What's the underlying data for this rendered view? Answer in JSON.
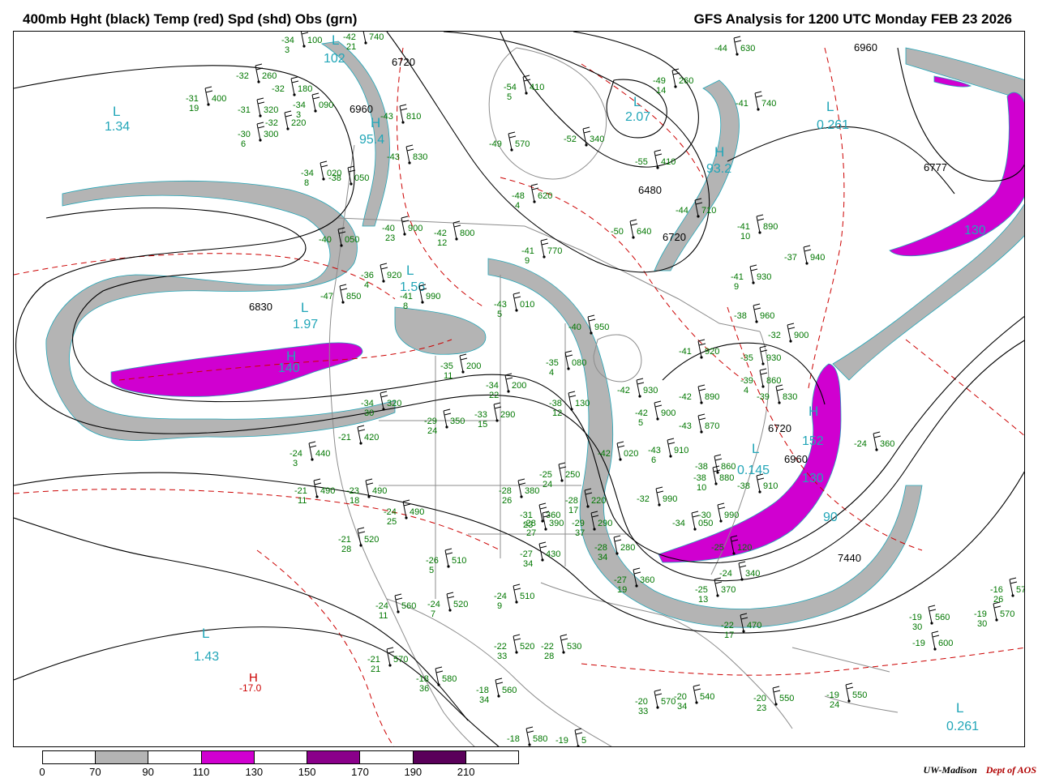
{
  "header": {
    "left_title": "400mb Hght (black) Temp (red) Spd (shd) Obs (grn)",
    "right_title": "GFS Analysis for 1200 UTC Monday  FEB 23 2026"
  },
  "colors": {
    "height_contour": "#000000",
    "temperature_contour": "#cc0000",
    "observation": "#007700",
    "pressure_center": "#22a6b8",
    "political_border": "#888888",
    "speed_70_90": "#b4b4b4",
    "speed_110_130": "#d000d0",
    "speed_150_170": "#8a008a",
    "speed_190_210": "#5a005a"
  },
  "legend": {
    "colors": [
      "#ffffff",
      "#b4b4b4",
      "#ffffff",
      "#d000d0",
      "#ffffff",
      "#8a008a",
      "#ffffff",
      "#5a005a",
      "#ffffff"
    ],
    "labels": [
      "0",
      "70",
      "90",
      "110",
      "130",
      "150",
      "170",
      "190",
      "210"
    ]
  },
  "credit": {
    "org": "UW-Madison",
    "dept": "Dept of AOS"
  },
  "height_labels": [
    "6720",
    "6960",
    "6480",
    "6720",
    "6830",
    "6777",
    "6960",
    "6720",
    "6960",
    "7440"
  ],
  "centers": [
    {
      "letter": "L",
      "value": "1.34"
    },
    {
      "letter": "L",
      "value": "102"
    },
    {
      "letter": "H",
      "value": "95.4"
    },
    {
      "letter": "L",
      "value": "1.56"
    },
    {
      "letter": "L",
      "value": "1.97"
    },
    {
      "letter": "H",
      "value": "140"
    },
    {
      "letter": "L",
      "value": "2.07"
    },
    {
      "letter": "H",
      "value": "93.2"
    },
    {
      "letter": "L",
      "value": "0.261"
    },
    {
      "letter": "L",
      "value": "0.145"
    },
    {
      "letter": "H",
      "value": "152"
    },
    {
      "letter": "L",
      "value": "1.43"
    },
    {
      "letter": "L",
      "value": "0.261"
    }
  ],
  "temp_high": {
    "letter": "H",
    "value": "-17.0"
  },
  "obs": [
    {
      "t": "-34",
      "h": "100",
      "d": "3"
    },
    {
      "t": "-42",
      "h": "740",
      "d": "21"
    },
    {
      "t": "-32",
      "h": "260",
      "d": ""
    },
    {
      "t": "-32",
      "h": "180",
      "d": ""
    },
    {
      "t": "-31",
      "h": "400",
      "d": "19"
    },
    {
      "t": "-34",
      "h": "090",
      "d": "3"
    },
    {
      "t": "-31",
      "h": "320",
      "d": ""
    },
    {
      "t": "-32",
      "h": "220",
      "d": ""
    },
    {
      "t": "-30",
      "h": "300",
      "d": "6"
    },
    {
      "t": "-43",
      "h": "810",
      "d": ""
    },
    {
      "t": "-43",
      "h": "830",
      "d": ""
    },
    {
      "t": "-34",
      "h": "020",
      "d": "8"
    },
    {
      "t": "-38",
      "h": "050",
      "d": ""
    },
    {
      "t": "-40",
      "h": "900",
      "d": "23"
    },
    {
      "t": "-40",
      "h": "050",
      "d": ""
    },
    {
      "t": "-42",
      "h": "800",
      "d": "12"
    },
    {
      "t": "-36",
      "h": "920",
      "d": "4"
    },
    {
      "t": "-41",
      "h": "990",
      "d": "8"
    },
    {
      "t": "-47",
      "h": "850",
      "d": ""
    },
    {
      "t": "-54",
      "h": "410",
      "d": "5"
    },
    {
      "t": "-49",
      "h": "570",
      "d": ""
    },
    {
      "t": "-52",
      "h": "340",
      "d": ""
    },
    {
      "t": "-49",
      "h": "260",
      "d": "14"
    },
    {
      "t": "-55",
      "h": "410",
      "d": ""
    },
    {
      "t": "-48",
      "h": "620",
      "d": "4"
    },
    {
      "t": "-44",
      "h": "630",
      "d": ""
    },
    {
      "t": "-41",
      "h": "740",
      "d": ""
    },
    {
      "t": "-44",
      "h": "710",
      "d": ""
    },
    {
      "t": "-50",
      "h": "640",
      "d": ""
    },
    {
      "t": "-41",
      "h": "770",
      "d": "9"
    },
    {
      "t": "-43",
      "h": "010",
      "d": "5"
    },
    {
      "t": "-40",
      "h": "950",
      "d": ""
    },
    {
      "t": "-41",
      "h": "890",
      "d": "10"
    },
    {
      "t": "-37",
      "h": "940",
      "d": ""
    },
    {
      "t": "-41",
      "h": "930",
      "d": "9"
    },
    {
      "t": "-38",
      "h": "960",
      "d": ""
    },
    {
      "t": "-32",
      "h": "900",
      "d": ""
    },
    {
      "t": "-35",
      "h": "200",
      "d": "11"
    },
    {
      "t": "-34",
      "h": "200",
      "d": "22"
    },
    {
      "t": "-35",
      "h": "080",
      "d": "4"
    },
    {
      "t": "-41",
      "h": "920",
      "d": ""
    },
    {
      "t": "-35",
      "h": "930",
      "d": ""
    },
    {
      "t": "-39",
      "h": "860",
      "d": "4"
    },
    {
      "t": "-39",
      "h": "830",
      "d": ""
    },
    {
      "t": "-42",
      "h": "930",
      "d": ""
    },
    {
      "t": "-42",
      "h": "890",
      "d": ""
    },
    {
      "t": "-38",
      "h": "130",
      "d": "12"
    },
    {
      "t": "-42",
      "h": "900",
      "d": "5"
    },
    {
      "t": "-43",
      "h": "870",
      "d": ""
    },
    {
      "t": "-34",
      "h": "320",
      "d": "30"
    },
    {
      "t": "-29",
      "h": "350",
      "d": "24"
    },
    {
      "t": "-33",
      "h": "290",
      "d": "15"
    },
    {
      "t": "-42",
      "h": "020",
      "d": ""
    },
    {
      "t": "-43",
      "h": "910",
      "d": "6"
    },
    {
      "t": "-38",
      "h": "860",
      "d": ""
    },
    {
      "t": "-38",
      "h": "880",
      "d": "10"
    },
    {
      "t": "-38",
      "h": "910",
      "d": ""
    },
    {
      "t": "-24",
      "h": "360",
      "d": ""
    },
    {
      "t": "-21",
      "h": "420",
      "d": ""
    },
    {
      "t": "-24",
      "h": "440",
      "d": "3"
    },
    {
      "t": "-21",
      "h": "490",
      "d": "11"
    },
    {
      "t": "-23",
      "h": "490",
      "d": "18"
    },
    {
      "t": "-24",
      "h": "490",
      "d": "25"
    },
    {
      "t": "-21",
      "h": "520",
      "d": "28"
    },
    {
      "t": "-25",
      "h": "250",
      "d": "24"
    },
    {
      "t": "-28",
      "h": "380",
      "d": "26"
    },
    {
      "t": "-28",
      "h": "220",
      "d": "17"
    },
    {
      "t": "-31",
      "h": "360",
      "d": "23"
    },
    {
      "t": "-28",
      "h": "390",
      "d": "27"
    },
    {
      "t": "-29",
      "h": "290",
      "d": "37"
    },
    {
      "t": "-32",
      "h": "990",
      "d": ""
    },
    {
      "t": "-34",
      "h": "050",
      "d": ""
    },
    {
      "t": "-30",
      "h": "990",
      "d": ""
    },
    {
      "t": "-26",
      "h": "510",
      "d": "5"
    },
    {
      "t": "-27",
      "h": "430",
      "d": "34"
    },
    {
      "t": "-28",
      "h": "280",
      "d": "34"
    },
    {
      "t": "-27",
      "h": "360",
      "d": "19"
    },
    {
      "t": "-25",
      "h": "120",
      "d": ""
    },
    {
      "t": "-24",
      "h": "340",
      "d": ""
    },
    {
      "t": "-25",
      "h": "370",
      "d": "13"
    },
    {
      "t": "-24",
      "h": "560",
      "d": "11"
    },
    {
      "t": "-24",
      "h": "520",
      "d": "7"
    },
    {
      "t": "-24",
      "h": "510",
      "d": "9"
    },
    {
      "t": "-22",
      "h": "470",
      "d": "17"
    },
    {
      "t": "-22",
      "h": "520",
      "d": "33"
    },
    {
      "t": "-22",
      "h": "530",
      "d": "28"
    },
    {
      "t": "-21",
      "h": "570",
      "d": "21"
    },
    {
      "t": "-18",
      "h": "580",
      "d": "36"
    },
    {
      "t": "-18",
      "h": "560",
      "d": "34"
    },
    {
      "t": "-20",
      "h": "570",
      "d": "33"
    },
    {
      "t": "-20",
      "h": "540",
      "d": "34"
    },
    {
      "t": "-20",
      "h": "550",
      "d": "23"
    },
    {
      "t": "-19",
      "h": "550",
      "d": "24"
    },
    {
      "t": "-19",
      "h": "570",
      "d": "30"
    },
    {
      "t": "-19",
      "h": "560",
      "d": "30"
    },
    {
      "t": "-19",
      "h": "600",
      "d": ""
    },
    {
      "t": "-18",
      "h": "580",
      "d": ""
    },
    {
      "t": "-19",
      "h": "5",
      "d": "27"
    },
    {
      "t": "-16",
      "h": "570",
      "d": "26"
    }
  ]
}
